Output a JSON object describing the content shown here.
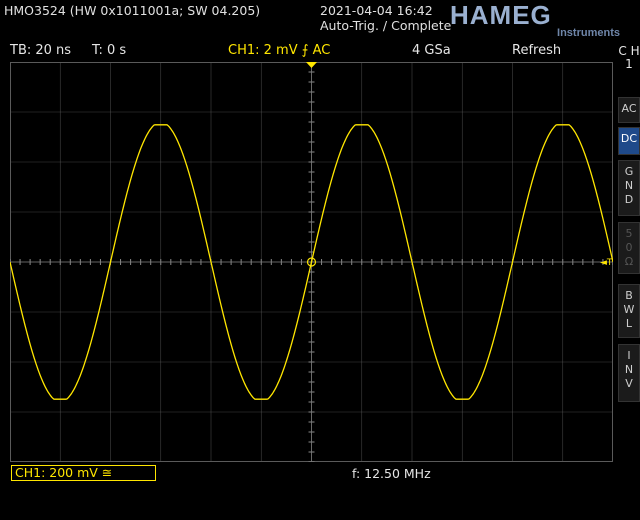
{
  "header": {
    "model": "HMO3524 (HW 0x1011001a; SW 04.205)",
    "datetime": "2021-04-04 16:42",
    "trigger_status": "Auto-Trig. / Complete",
    "brand": "HAMEG",
    "brand_sub": "Instruments"
  },
  "status_bar": {
    "timebase": "TB: 20 ns",
    "trigger_time": "T: 0 s",
    "channel": "CH1: 2 mV ⨍ AC",
    "sample_rate": "4 GSa",
    "mode": "Refresh"
  },
  "side_panel": {
    "channel_tag": "C H 1",
    "buttons": [
      {
        "label": "AC",
        "active": false
      },
      {
        "label": "DC",
        "active": true
      },
      {
        "label": "GND",
        "active": false
      },
      {
        "label": "50Ω",
        "active": false
      },
      {
        "label": "BWL",
        "active": false
      },
      {
        "label": "INV",
        "active": false
      }
    ]
  },
  "footer": {
    "channel_scale": "CH1: 200 mV ≅",
    "frequency": "f: 12.50 MHz"
  },
  "trace": {
    "color": "#ffe600",
    "frequency_mhz": 12.5,
    "timebase_ns_per_div": 20,
    "peak_divisions": 2.8,
    "phase_deg": 180
  },
  "colors": {
    "grid": "#5a5a5a",
    "accent": "#ffe600",
    "active_button": "#1f4a8a"
  }
}
